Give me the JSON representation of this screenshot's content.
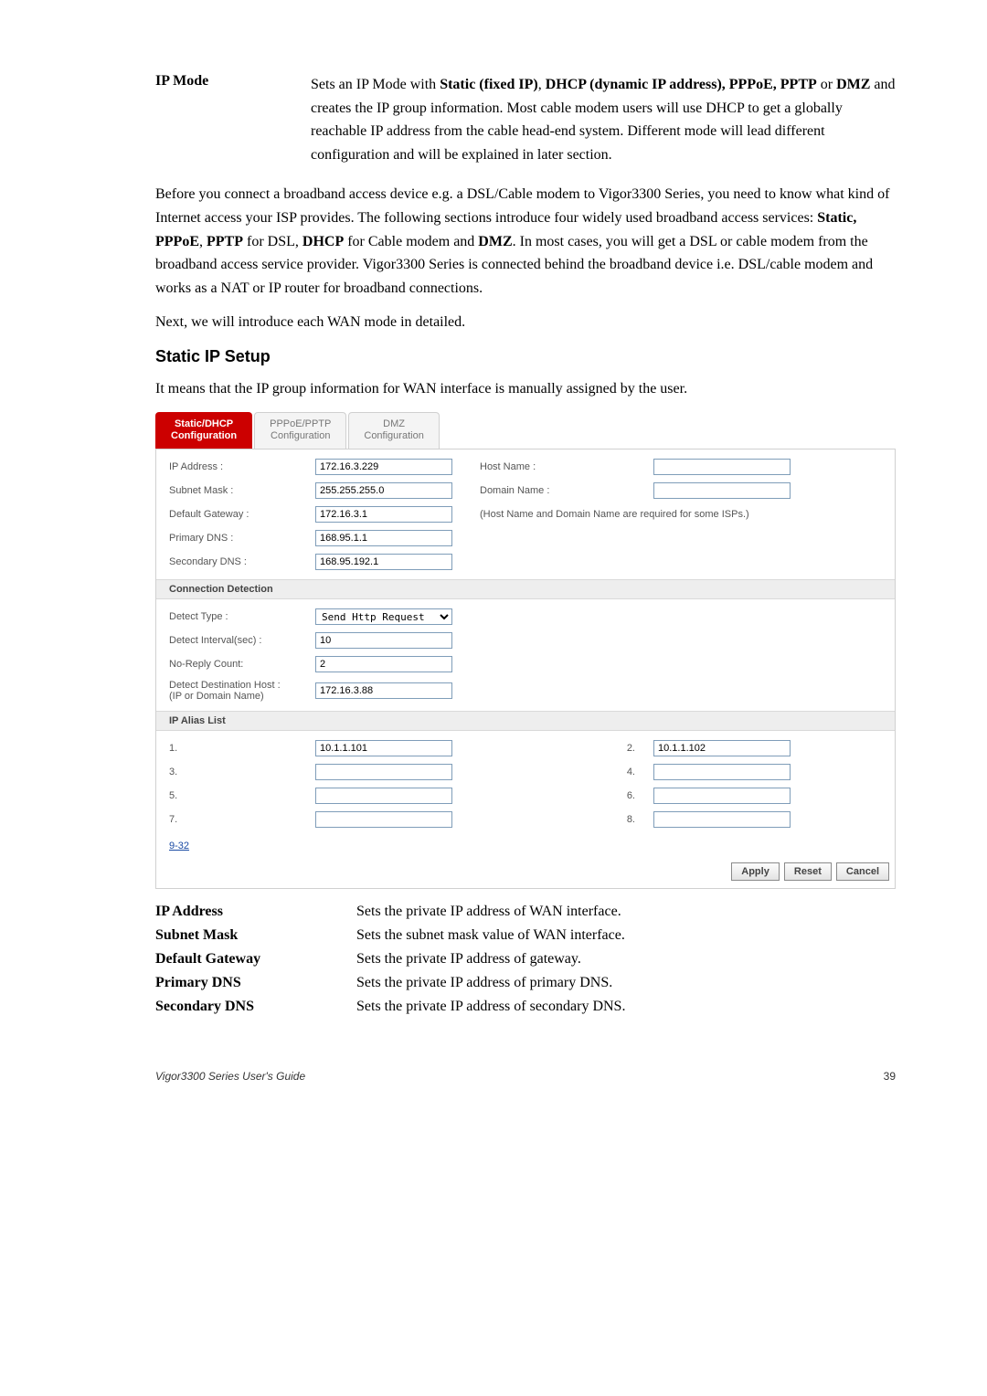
{
  "ipmode": {
    "term": "IP Mode",
    "desc": "Sets an IP Mode with Static (fixed IP), DHCP (dynamic IP address), PPPoE, PPTP or DMZ and creates the IP group information. Most cable modem users will use DHCP to get a globally reachable IP address from the cable head-end system. Different mode will lead different configuration and will be explained in later section.",
    "strong_parts": [
      "Static (fixed IP)",
      "DHCP (dynamic IP address), PPPoE, PPTP",
      "DMZ"
    ]
  },
  "intro1": {
    "pre": "Before you connect a broadband access device e.g. a DSL/Cable modem to Vigor3300 Series, you need to know what kind of Internet access your ISP provides. The following sections introduce four widely used broadband access services: ",
    "s1": "Static, PPPoE",
    "c1": ", ",
    "s2": "PPTP",
    "c2": " for DSL, ",
    "s3": "DHCP",
    "c3": " for Cable modem and ",
    "s4": "DMZ",
    "post": ". In most cases, you will get a DSL or cable modem from the broadband access service provider. Vigor3300 Series is connected behind the broadband device i.e. DSL/cable modem and works as a NAT or IP router for broadband connections."
  },
  "intro2": "Next, we will introduce each WAN mode in detailed.",
  "section_head": "Static IP Setup",
  "section_lead": "It means that the IP group information for WAN interface is manually assigned by the user.",
  "tabs": {
    "t1": {
      "l1": "Static/DHCP",
      "l2": "Configuration"
    },
    "t2": {
      "l1": "PPPoE/PPTP",
      "l2": "Configuration"
    },
    "t3": {
      "l1": "DMZ",
      "l2": "Configuration"
    }
  },
  "form": {
    "ip_label": "IP Address :",
    "ip": "172.16.3.229",
    "mask_label": "Subnet Mask :",
    "mask": "255.255.255.0",
    "gw_label": "Default Gateway :",
    "gw": "172.16.3.1",
    "pdns_label": "Primary DNS :",
    "pdns": "168.95.1.1",
    "sdns_label": "Secondary DNS :",
    "sdns": "168.95.192.1",
    "host_label": "Host Name :",
    "host": "",
    "domain_label": "Domain Name :",
    "domain": "",
    "note": "(Host Name and Domain Name are required for some ISPs.)"
  },
  "cd_head": "Connection Detection",
  "cd": {
    "type_label": "Detect Type :",
    "type": "Send Http Request",
    "interval_label": "Detect Interval(sec) :",
    "interval": "10",
    "noreply_label": "No-Reply Count:",
    "noreply": "2",
    "dest_label1": "Detect Destination Host :",
    "dest_label2": "(IP or Domain Name)",
    "dest": "172.16.3.88"
  },
  "alias_head": "IP Alias List",
  "alias": {
    "n1": "1.",
    "v1": "10.1.1.101",
    "n2": "2.",
    "v2": "10.1.1.102",
    "n3": "3.",
    "v3": "",
    "n4": "4.",
    "v4": "",
    "n5": "5.",
    "v5": "",
    "n6": "6.",
    "v6": "",
    "n7": "7.",
    "v7": "",
    "n8": "8.",
    "v8": "",
    "link": "9-32"
  },
  "buttons": {
    "apply": "Apply",
    "reset": "Reset",
    "cancel": "Cancel"
  },
  "defs": {
    "ip_t": "IP Address",
    "ip_d": "Sets the private IP address of WAN interface.",
    "mask_t": "Subnet Mask",
    "mask_d": "Sets the subnet mask value of WAN interface.",
    "gw_t": "Default Gateway",
    "gw_d": "Sets the private IP address of gateway.",
    "pdns_t": "Primary DNS",
    "pdns_d": "Sets the private IP address of primary DNS.",
    "sdns_t": "Secondary DNS",
    "sdns_d": "Sets the private IP address of secondary DNS."
  },
  "footer": {
    "left": "Vigor3300 Series User's Guide",
    "right": "39"
  }
}
